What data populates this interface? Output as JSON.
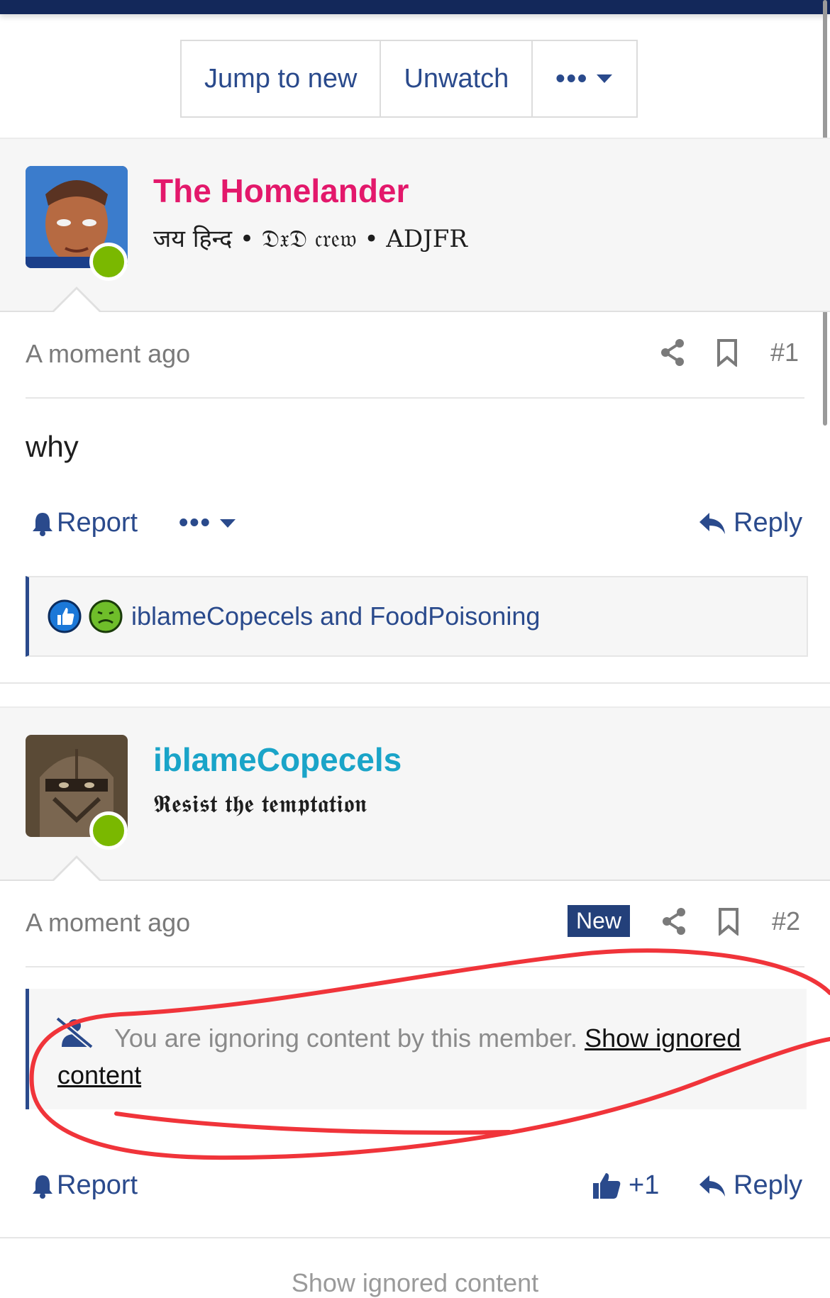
{
  "toolbar": {
    "jump_label": "Jump to new",
    "unwatch_label": "Unwatch",
    "more_label": "•••"
  },
  "posts": [
    {
      "username": "The Homelander",
      "username_color": "#e3186b",
      "user_title": "जय हिन्द • 𝔇𝔵𝔇 𝔠𝔯𝔢𝔴 • ADJFR",
      "timestamp": "A moment ago",
      "post_number": "#1",
      "message": "why",
      "report_label": "Report",
      "more_label": "•••",
      "reply_label": "Reply",
      "reactions_text": "iblameCopecels and FoodPoisoning"
    },
    {
      "username": "iblameCopecels",
      "username_color": "#1aa4c8",
      "user_title": "𝕽𝖊𝖘𝖎𝖘𝖙 𝖙𝖍𝖊 𝖙𝖊𝖒𝖕𝖙𝖆𝖙𝖎𝖔𝖓",
      "timestamp": "A moment ago",
      "new_badge": "New",
      "post_number": "#2",
      "ignored_text": "You are ignoring content by this member.",
      "show_ignored_label": "Show ignored content",
      "report_label": "Report",
      "like_count": "+1",
      "reply_label": "Reply"
    }
  ],
  "footer": {
    "show_ignored_label": "Show ignored content"
  },
  "colors": {
    "link_blue": "#2a4a8c",
    "online_green": "#7ab800",
    "annotation_red": "#f0343a"
  }
}
